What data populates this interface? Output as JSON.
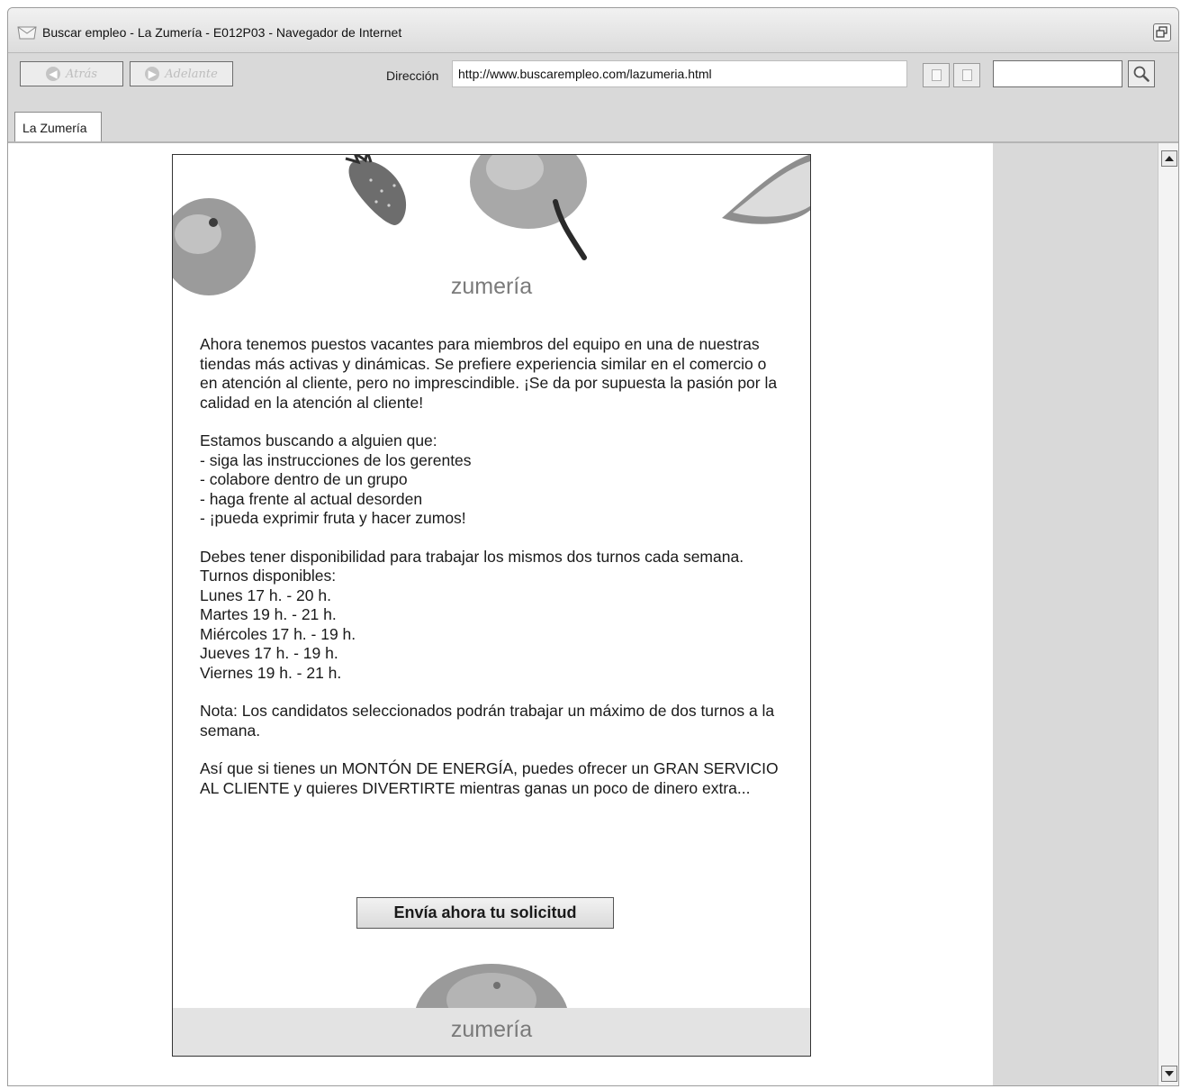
{
  "window": {
    "title": "Buscar empleo - La Zumería - E012P03 - Navegador de Internet"
  },
  "toolbar": {
    "back_label": "Atrás",
    "forward_label": "Adelante",
    "address_label": "Dirección",
    "address_value": "http://www.buscarempleo.com/lazumeria.html",
    "search_value": ""
  },
  "tabs": [
    {
      "label": "La Zumería"
    }
  ],
  "page": {
    "brand_top": "zumería",
    "intro": "Ahora tenemos puestos vacantes para miembros del equipo en una de nuestras tiendas más activas y dinámicas. Se prefiere experiencia similar en el comercio o en atención al cliente, pero no imprescindible. ¡Se da por supuesta la pasión por la calidad en la atención al cliente!",
    "requirements_heading": "Estamos buscando a alguien que:",
    "requirements": [
      "- siga las instrucciones de los gerentes",
      "- colabore dentro de un grupo",
      "- haga frente al actual desorden",
      "- ¡pueda exprimir fruta y hacer zumos!"
    ],
    "availability": "Debes tener disponibilidad para trabajar los mismos dos turnos cada semana.",
    "shifts_heading": "Turnos disponibles:",
    "shifts": [
      "Lunes 17 h. - 20 h.",
      "Martes 19 h. - 21 h.",
      "Miércoles 17 h. - 19 h.",
      "Jueves 17 h. - 19 h.",
      "Viernes 19 h. - 21 h."
    ],
    "note": "Nota: Los candidatos seleccionados podrán trabajar un máximo de dos turnos a la semana.",
    "closing": "Así que si tienes un MONTÓN DE ENERGÍA, puedes ofrecer un GRAN SERVICIO AL CLIENTE y quieres DIVERTIRTE mientras ganas un poco de dinero extra...",
    "apply_button": "Envía ahora tu solicitud",
    "brand_footer": "zumería"
  },
  "icons": {
    "app": "envelope-icon",
    "back": "arrow-left-icon",
    "forward": "arrow-right-icon",
    "copy": "copy-icon",
    "paste": "paste-icon",
    "search": "magnifier-icon",
    "restore": "window-restore-icon",
    "scroll_up": "arrow-up-icon",
    "scroll_down": "arrow-down-icon"
  }
}
